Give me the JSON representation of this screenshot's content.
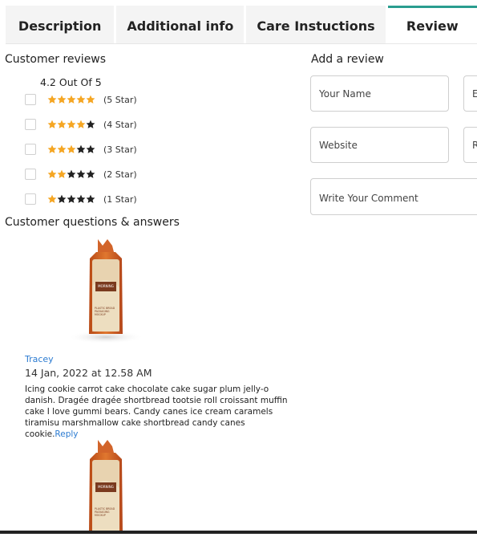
{
  "tabs": [
    {
      "label": "Description",
      "active": false
    },
    {
      "label": "Additional info",
      "active": false
    },
    {
      "label": "Care Instuctions",
      "active": false
    },
    {
      "label": "Review",
      "active": true
    }
  ],
  "colors": {
    "accent": "#2a9d8f",
    "star_filled": "#f5a623",
    "star_empty": "#222222",
    "link": "#2b7bd1"
  },
  "reviews": {
    "heading": "Customer reviews",
    "summary": "4.2 Out Of 5",
    "rows": [
      {
        "stars": 5,
        "label": "(5 Star)"
      },
      {
        "stars": 4,
        "label": "(4 Star)"
      },
      {
        "stars": 3,
        "label": "(3 Star)"
      },
      {
        "stars": 2,
        "label": "(2 Star)"
      },
      {
        "stars": 1,
        "label": "(1 Star)"
      }
    ]
  },
  "qa": {
    "heading": "Customer questions & answers",
    "items": [
      {
        "author": "Tracey",
        "date": "14 Jan, 2022 at 12.58 AM",
        "text": "Icing cookie carrot cake chocolate cake sugar plum jelly-o danish. Dragée dragée shortbread tootsie roll croissant muffin cake I love gummi bears. Candy canes ice cream caramels tiramisu marshmallow cake shortbread candy canes cookie.",
        "reply_label": "Reply"
      }
    ]
  },
  "product_label": {
    "line1": "MORNING",
    "line2": "PLASTIC BREAD PACKAGING MOCKUP"
  },
  "add_review": {
    "heading": "Add a review",
    "name_placeholder": "Your Name",
    "email_placeholder": "E",
    "website_placeholder": "Website",
    "rating_placeholder": "R",
    "comment_placeholder": "Write Your Comment"
  }
}
